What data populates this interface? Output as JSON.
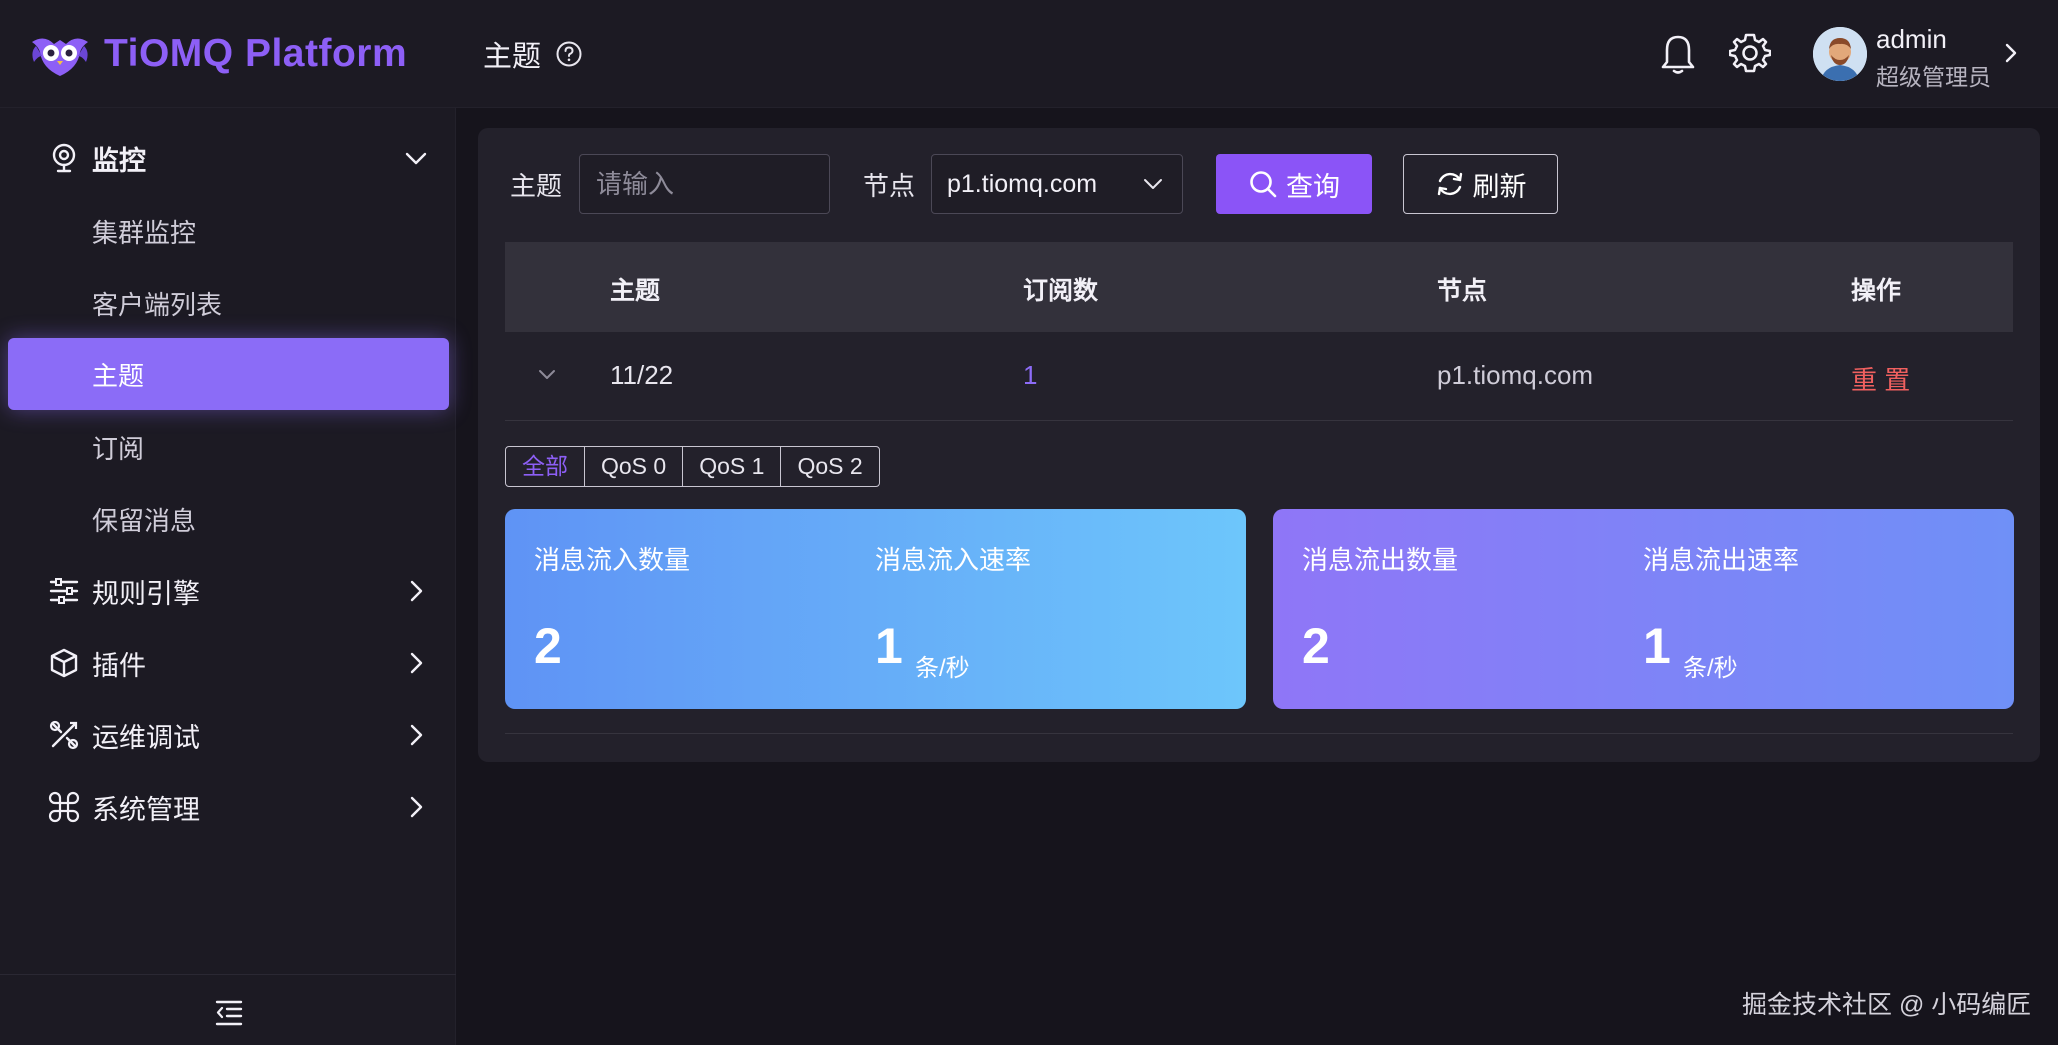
{
  "header": {
    "brand": "TiOMQ Platform",
    "page_title": "主题",
    "user": {
      "name": "admin",
      "role": "超级管理员"
    }
  },
  "sidebar": {
    "groups": [
      {
        "label": "监控",
        "icon": "monitor-icon",
        "expanded": true,
        "items": [
          {
            "label": "集群监控"
          },
          {
            "label": "客户端列表"
          },
          {
            "label": "主题",
            "active": true
          },
          {
            "label": "订阅"
          },
          {
            "label": "保留消息"
          }
        ]
      },
      {
        "label": "规则引擎",
        "icon": "sliders-icon",
        "expanded": false
      },
      {
        "label": "插件",
        "icon": "cube-icon",
        "expanded": false
      },
      {
        "label": "运维调试",
        "icon": "tools-icon",
        "expanded": false
      },
      {
        "label": "系统管理",
        "icon": "command-icon",
        "expanded": false
      }
    ]
  },
  "filters": {
    "topic_label": "主题",
    "topic_placeholder": "请输入",
    "node_label": "节点",
    "node_value": "p1.tiomq.com",
    "query_label": "查询",
    "refresh_label": "刷新"
  },
  "table": {
    "columns": [
      "主题",
      "订阅数",
      "节点",
      "操作"
    ],
    "rows": [
      {
        "topic": "11/22",
        "subscriptions": "1",
        "node": "p1.tiomq.com",
        "action": "重 置"
      }
    ]
  },
  "qos_tabs": [
    {
      "label": "全部",
      "active": true
    },
    {
      "label": "QoS 0"
    },
    {
      "label": "QoS 1"
    },
    {
      "label": "QoS 2"
    }
  ],
  "stats": {
    "in": {
      "count_label": "消息流入数量",
      "count_value": "2",
      "rate_label": "消息流入速率",
      "rate_value": "1",
      "rate_unit": "条/秒"
    },
    "out": {
      "count_label": "消息流出数量",
      "count_value": "2",
      "rate_label": "消息流出速率",
      "rate_value": "1",
      "rate_unit": "条/秒"
    }
  },
  "watermark": "掘金技术社区 @ 小码编匠",
  "colors": {
    "accent": "#8b54f7",
    "brand": "#8d5ff6",
    "danger": "#f0605f",
    "active_menu": "#8b6cf7"
  }
}
